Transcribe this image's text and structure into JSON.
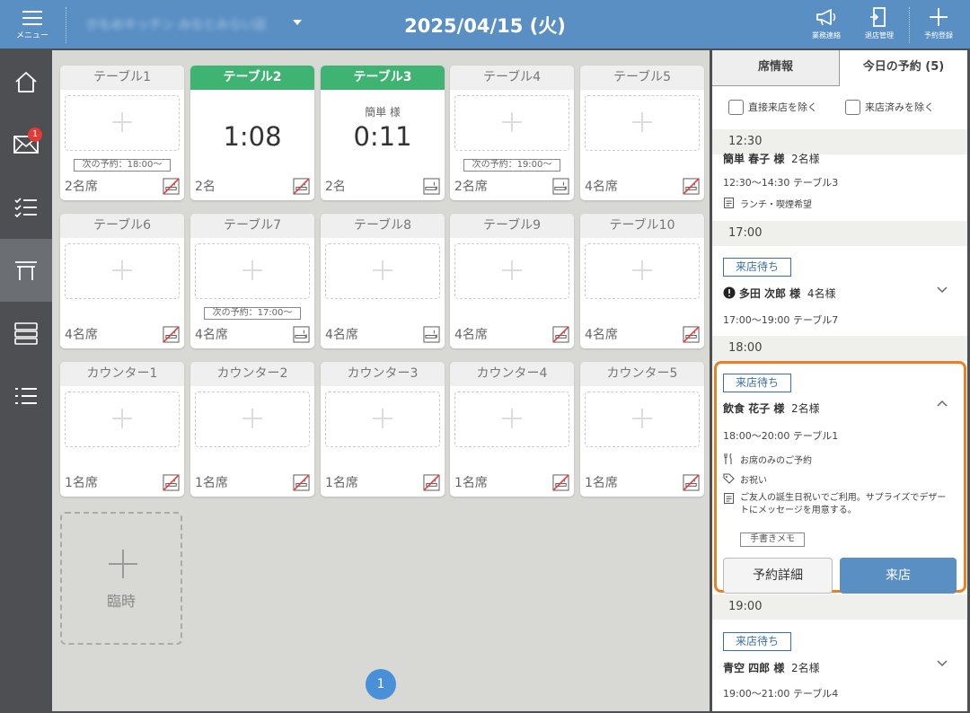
{
  "header": {
    "menu_label": "メニュー",
    "store_name": "かもめキッチン みなとみらい店",
    "date": "2025/04/15 (火)",
    "buttons": [
      {
        "label": "業務連絡",
        "icon": "megaphone-icon"
      },
      {
        "label": "退店管理",
        "icon": "exit-door-icon"
      },
      {
        "label": "予約登録",
        "icon": "plus-icon"
      }
    ]
  },
  "sidebar": {
    "items": [
      {
        "icon": "home-icon"
      },
      {
        "icon": "mail-icon",
        "badge": "1"
      },
      {
        "icon": "checklist-icon"
      },
      {
        "icon": "table-icon",
        "active": true
      },
      {
        "icon": "layout-rows-icon"
      },
      {
        "icon": "list-icon"
      }
    ]
  },
  "tables": {
    "row1": [
      {
        "name": "テーブル1",
        "seats": "2名席",
        "next": "次の予約：18:00〜",
        "icon": "no-smoking-icon"
      },
      {
        "name": "テーブル2",
        "occupied": true,
        "timer": "1:08",
        "seats": "2名",
        "icon": "no-smoking-icon"
      },
      {
        "name": "テーブル3",
        "occupied": true,
        "guest": "簡単 様",
        "timer": "0:11",
        "seats": "2名",
        "icon": "smoking-icon"
      },
      {
        "name": "テーブル4",
        "seats": "2名席",
        "next": "次の予約：19:00〜",
        "icon": "smoking-icon"
      },
      {
        "name": "テーブル5",
        "seats": "4名席",
        "icon": "no-smoking-icon"
      }
    ],
    "row2": [
      {
        "name": "テーブル6",
        "seats": "4名席",
        "icon": "no-smoking-icon"
      },
      {
        "name": "テーブル7",
        "seats": "4名席",
        "next": "次の予約：17:00〜",
        "icon": "smoking-icon"
      },
      {
        "name": "テーブル8",
        "seats": "4名席",
        "icon": "smoking-icon"
      },
      {
        "name": "テーブル9",
        "seats": "4名席",
        "icon": "no-smoking-icon"
      },
      {
        "name": "テーブル10",
        "seats": "4名席",
        "icon": "no-smoking-icon"
      }
    ],
    "row3": [
      {
        "name": "カウンター1",
        "seats": "1名席",
        "icon": "no-smoking-icon"
      },
      {
        "name": "カウンター2",
        "seats": "1名席",
        "icon": "no-smoking-icon"
      },
      {
        "name": "カウンター3",
        "seats": "1名席",
        "icon": "no-smoking-icon"
      },
      {
        "name": "カウンター4",
        "seats": "1名席",
        "icon": "no-smoking-icon"
      },
      {
        "name": "カウンター5",
        "seats": "1名席",
        "icon": "no-smoking-icon"
      }
    ],
    "temp_label": "臨時"
  },
  "pager": {
    "current": "1"
  },
  "panel": {
    "tabs": [
      "席情報",
      "今日の予約 (5)"
    ],
    "filters": [
      "直接来店を除く",
      "来店済みを除く"
    ],
    "groups": {
      "g1230": "12:30",
      "g1700": "17:00",
      "g1800": "18:00",
      "g1900": "19:00"
    },
    "r1": {
      "name": "簡単 春子 様",
      "party": "2名様",
      "time": "12:30〜14:30 テーブル3",
      "note": "ランチ・喫煙希望"
    },
    "r2": {
      "status": "来店待ち",
      "name": "多田 次郎 様",
      "party": "4名様",
      "time": "17:00〜19:00 テーブル7"
    },
    "r3": {
      "status": "来店待ち",
      "name": "飲食 花子 様",
      "party": "2名様",
      "time": "18:00〜20:00 テーブル1",
      "course": "お席のみのご予約",
      "tag": "お祝い",
      "memo": "ご友人の誕生日祝いでご利用。サプライズでデザートにメッセージを用意する。",
      "hand_memo": "手書きメモ",
      "detail_btn": "予約詳細",
      "visit_btn": "来店"
    },
    "r4": {
      "status": "来店待ち",
      "name": "青空 四郎 様",
      "party": "2名様",
      "time": "19:00〜21:00 テーブル4"
    }
  }
}
